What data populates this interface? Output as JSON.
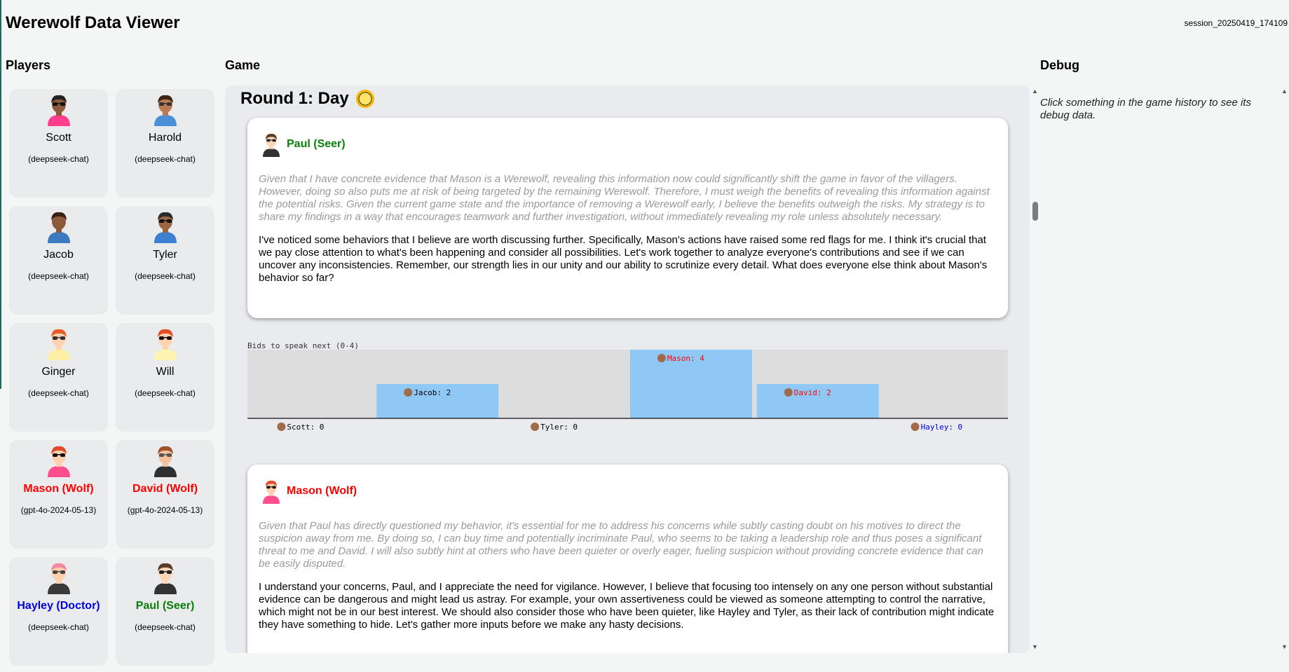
{
  "header": {
    "title": "Werewolf Data Viewer",
    "session": "session_20250419_174109"
  },
  "sections": {
    "players": "Players",
    "game": "Game",
    "debug": "Debug"
  },
  "players": [
    {
      "name": "Scott",
      "model": "(deepseek-chat)",
      "role": "villager",
      "avatar": "scott-avatar-icon"
    },
    {
      "name": "Harold",
      "model": "(deepseek-chat)",
      "role": "villager",
      "avatar": "harold-avatar-icon"
    },
    {
      "name": "Jacob",
      "model": "(deepseek-chat)",
      "role": "villager",
      "avatar": "jacob-avatar-icon"
    },
    {
      "name": "Tyler",
      "model": "(deepseek-chat)",
      "role": "villager",
      "avatar": "tyler-avatar-icon"
    },
    {
      "name": "Ginger",
      "model": "(deepseek-chat)",
      "role": "villager",
      "avatar": "ginger-avatar-icon"
    },
    {
      "name": "Will",
      "model": "(deepseek-chat)",
      "role": "villager",
      "avatar": "will-avatar-icon"
    },
    {
      "name": "Mason (Wolf)",
      "model": "(gpt-4o-2024-05-13)",
      "role": "wolf",
      "avatar": "mason-avatar-icon"
    },
    {
      "name": "David (Wolf)",
      "model": "(gpt-4o-2024-05-13)",
      "role": "wolf",
      "avatar": "david-avatar-icon"
    },
    {
      "name": "Hayley (Doctor)",
      "model": "(deepseek-chat)",
      "role": "doctor",
      "avatar": "hayley-avatar-icon"
    },
    {
      "name": "Paul (Seer)",
      "model": "(deepseek-chat)",
      "role": "seer",
      "avatar": "paul-avatar-icon"
    }
  ],
  "game": {
    "round_title": "Round 1: Day",
    "round_icon": "sun-icon",
    "messages": [
      {
        "speaker": "Paul (Seer)",
        "role": "seer",
        "thought": "Given that I have concrete evidence that Mason is a Werewolf, revealing this information now could significantly shift the game in favor of the villagers. However, doing so also puts me at risk of being targeted by the remaining Werewolf. Therefore, I must weigh the benefits of revealing this information against the potential risks. Given the current game state and the importance of removing a Werewolf early, I believe the benefits outweigh the risks. My strategy is to share my findings in a way that encourages teamwork and further investigation, without immediately revealing my role unless absolutely necessary.",
        "text": "I've noticed some behaviors that I believe are worth discussing further. Specifically, Mason's actions have raised some red flags for me. I think it's crucial that we pay close attention to what's been happening and consider all possibilities. Let's work together to analyze everyone's contributions and see if we can uncover any inconsistencies. Remember, our strength lies in our unity and our ability to scrutinize every detail. What does everyone else think about Mason's behavior so far?"
      },
      {
        "speaker": "Mason (Wolf)",
        "role": "wolf",
        "thought": "Given that Paul has directly questioned my behavior, it's essential for me to address his concerns while subtly casting doubt on his motives to direct the suspicion away from me. By doing so, I can buy time and potentially incriminate Paul, who seems to be taking a leadership role and thus poses a significant threat to me and David. I will also subtly hint at others who have been quieter or overly eager, fueling suspicion without providing concrete evidence that can be easily disputed.",
        "text": "I understand your concerns, Paul, and I appreciate the need for vigilance. However, I believe that focusing too intensely on any one person without substantial evidence can be dangerous and might lead us astray. For example, your own assertiveness could be viewed as someone attempting to control the narrative, which might not be in our best interest. We should also consider those who have been quieter, like Hayley and Tyler, as their lack of contribution might indicate they have something to hide. Let's gather more inputs before we make any hasty decisions."
      }
    ],
    "bids_title": "Bids to speak next (0-4)"
  },
  "chart_data": {
    "type": "bar",
    "title": "Bids to speak next (0-4)",
    "categories": [
      "Scott",
      "Jacob",
      "Tyler",
      "Mason",
      "David",
      "Hayley"
    ],
    "values": [
      0,
      2,
      0,
      4,
      2,
      0
    ],
    "labels": [
      "Scott: 0",
      "Jacob: 2",
      "Tyler: 0",
      "Mason: 4",
      "David: 2",
      "Hayley: 0"
    ],
    "label_colors": [
      "#000000",
      "#000000",
      "#000000",
      "#ff0000",
      "#ff0000",
      "#0000e0"
    ],
    "ylim": [
      0,
      4
    ],
    "bar_color": "#90c8f5",
    "background": "#dddddd"
  },
  "debug": {
    "hint": "Click something in the game history to see its debug data."
  },
  "colors": {
    "wolf": "#ff0000",
    "doctor": "#0000e0",
    "seer": "#0a7d0a"
  }
}
